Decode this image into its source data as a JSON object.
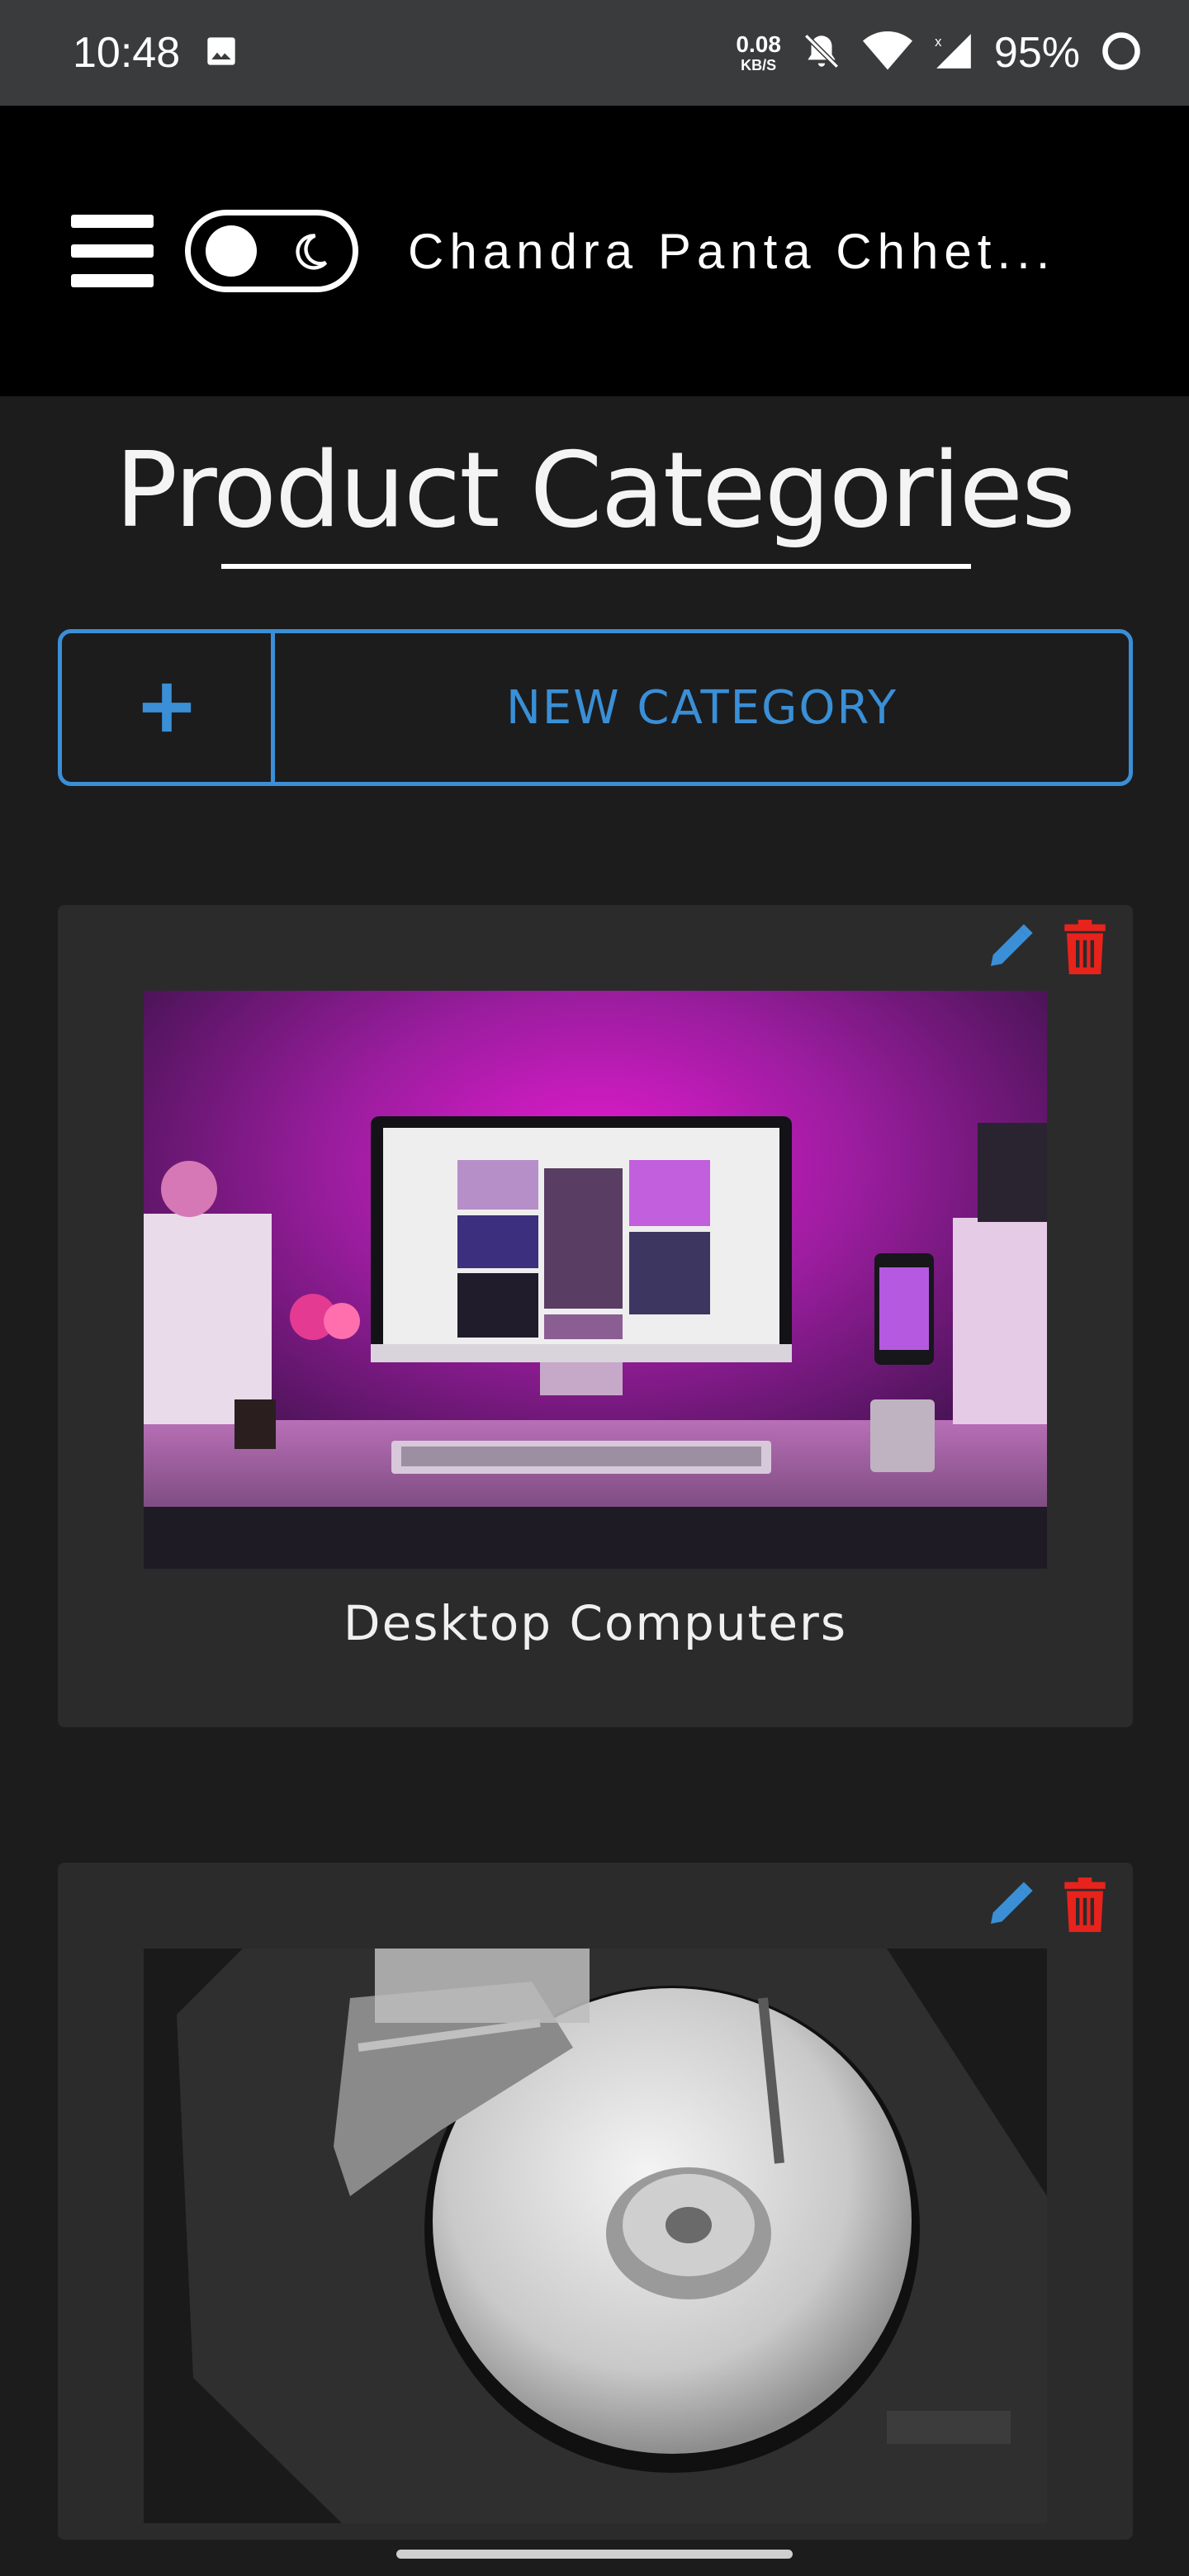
{
  "status_bar": {
    "time": "10:48",
    "net_speed_value": "0.08",
    "net_speed_unit": "KB/S",
    "battery": "95%",
    "icons": [
      "image-icon",
      "bell-off-icon",
      "wifi-icon",
      "signal-icon",
      "battery-icon"
    ]
  },
  "header": {
    "site_name": "Chandra Panta Chhet...",
    "menu_icon": "hamburger-icon",
    "theme_toggle_icon": "moon-icon"
  },
  "main": {
    "title": "Product Categories",
    "new_category_label": "NEW CATEGORY",
    "accent_color": "#3a8fd6",
    "delete_color": "#e8231c",
    "categories": [
      {
        "name": "Desktop Computers",
        "image": "desk-setup-photo"
      },
      {
        "name": "",
        "image": "hard-drive-photo"
      }
    ]
  }
}
